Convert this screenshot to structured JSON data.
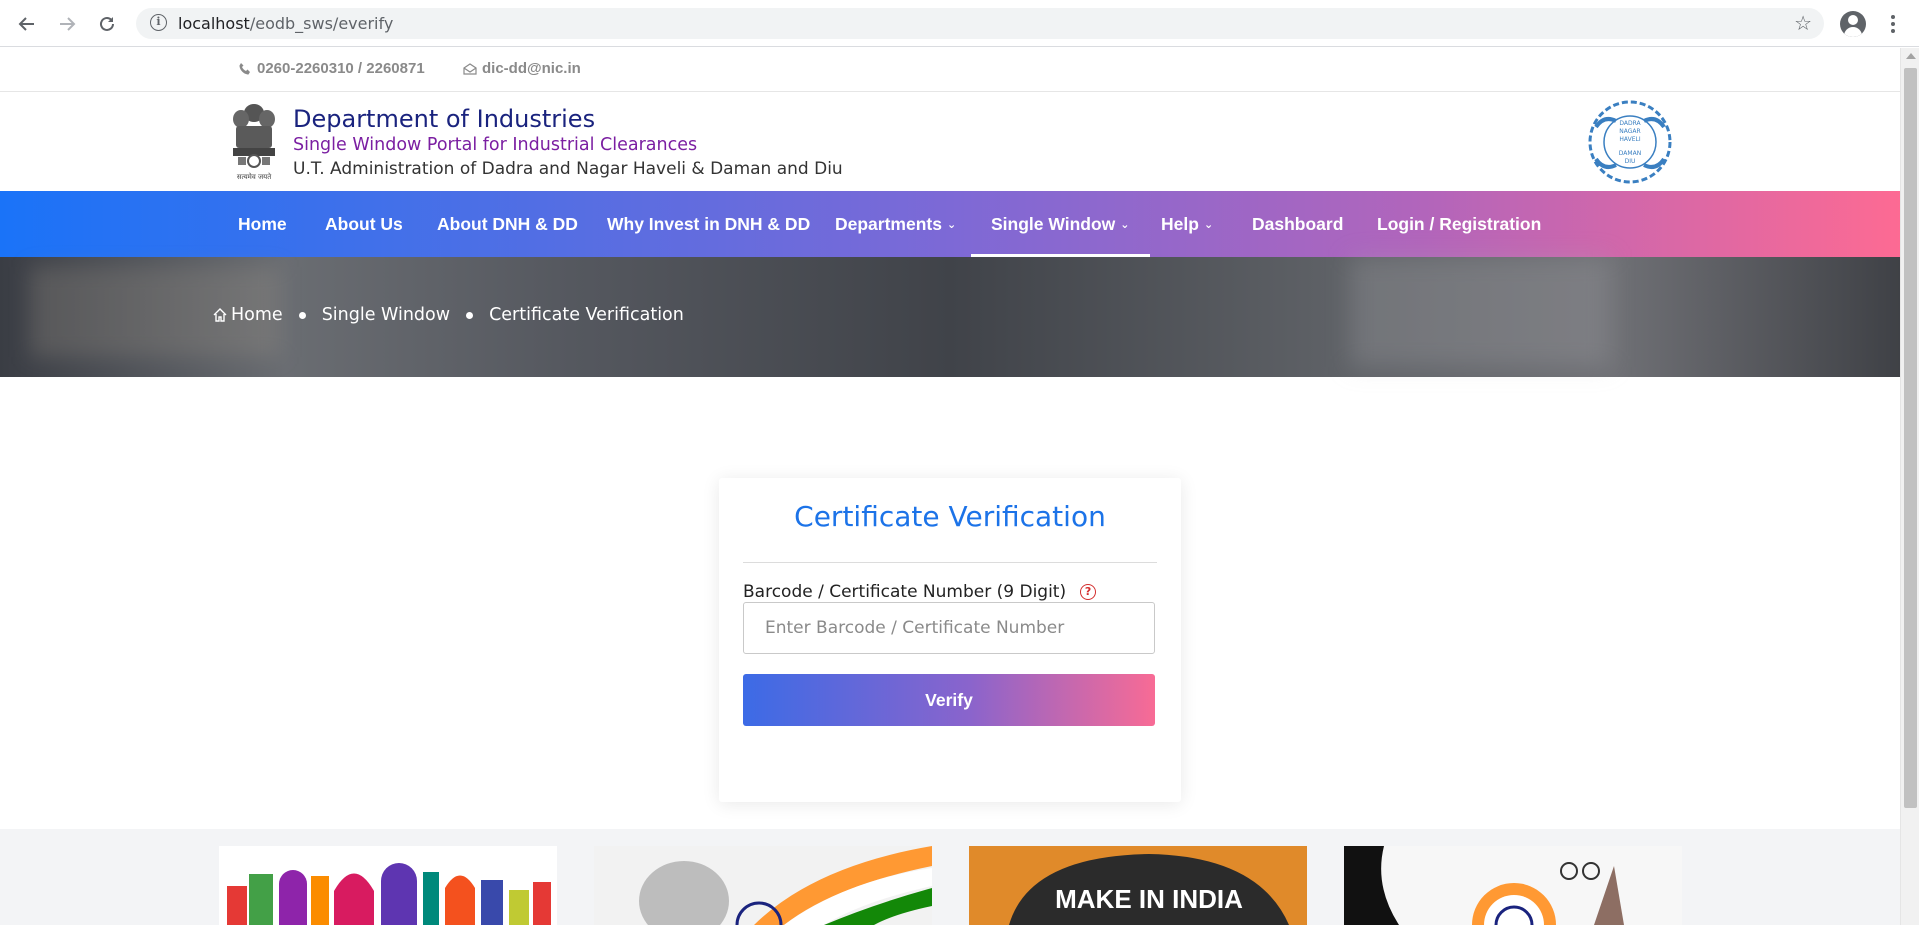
{
  "browser": {
    "url_host": "localhost",
    "url_path": "/eodb_sws/everify"
  },
  "topbar": {
    "phone": "0260-2260310 / 2260871",
    "email": "dic-dd@nic.in"
  },
  "header": {
    "title": "Department of Industries",
    "subtitle": "Single Window Portal for Industrial Clearances",
    "administration": "U.T. Administration of Dadra and Nagar Haveli & Daman and Diu",
    "emblem_caption": "सत्यमेव जयते",
    "seal_lines": [
      "DADRA",
      "NAGAR",
      "HAVELI",
      "DAMAN",
      "DIU"
    ]
  },
  "nav": {
    "items": [
      {
        "label": "Home"
      },
      {
        "label": "About Us"
      },
      {
        "label": "About DNH & DD"
      },
      {
        "label": "Why Invest in DNH & DD"
      },
      {
        "label": "Departments",
        "dropdown": true
      },
      {
        "label": "Single Window",
        "dropdown": true,
        "active": true
      },
      {
        "label": "Help",
        "dropdown": true
      },
      {
        "label": "Dashboard"
      },
      {
        "label": "Login / Registration"
      }
    ]
  },
  "breadcrumb": {
    "home": "Home",
    "section": "Single Window",
    "current": "Certificate Verification"
  },
  "form": {
    "title": "Certificate Verification",
    "label": "Barcode / Certificate Number (9 Digit)",
    "help_symbol": "?",
    "placeholder": "Enter Barcode / Certificate Number",
    "value": "",
    "button": "Verify"
  },
  "banners": {
    "make_in_india": "MAKE IN INDIA"
  },
  "colors": {
    "nav_gradient_start": "#1a73f8",
    "nav_gradient_end": "#fd6a93",
    "title_blue": "#1c73e8",
    "header_title": "#1a237e",
    "header_subtitle": "#7b1fa2"
  }
}
